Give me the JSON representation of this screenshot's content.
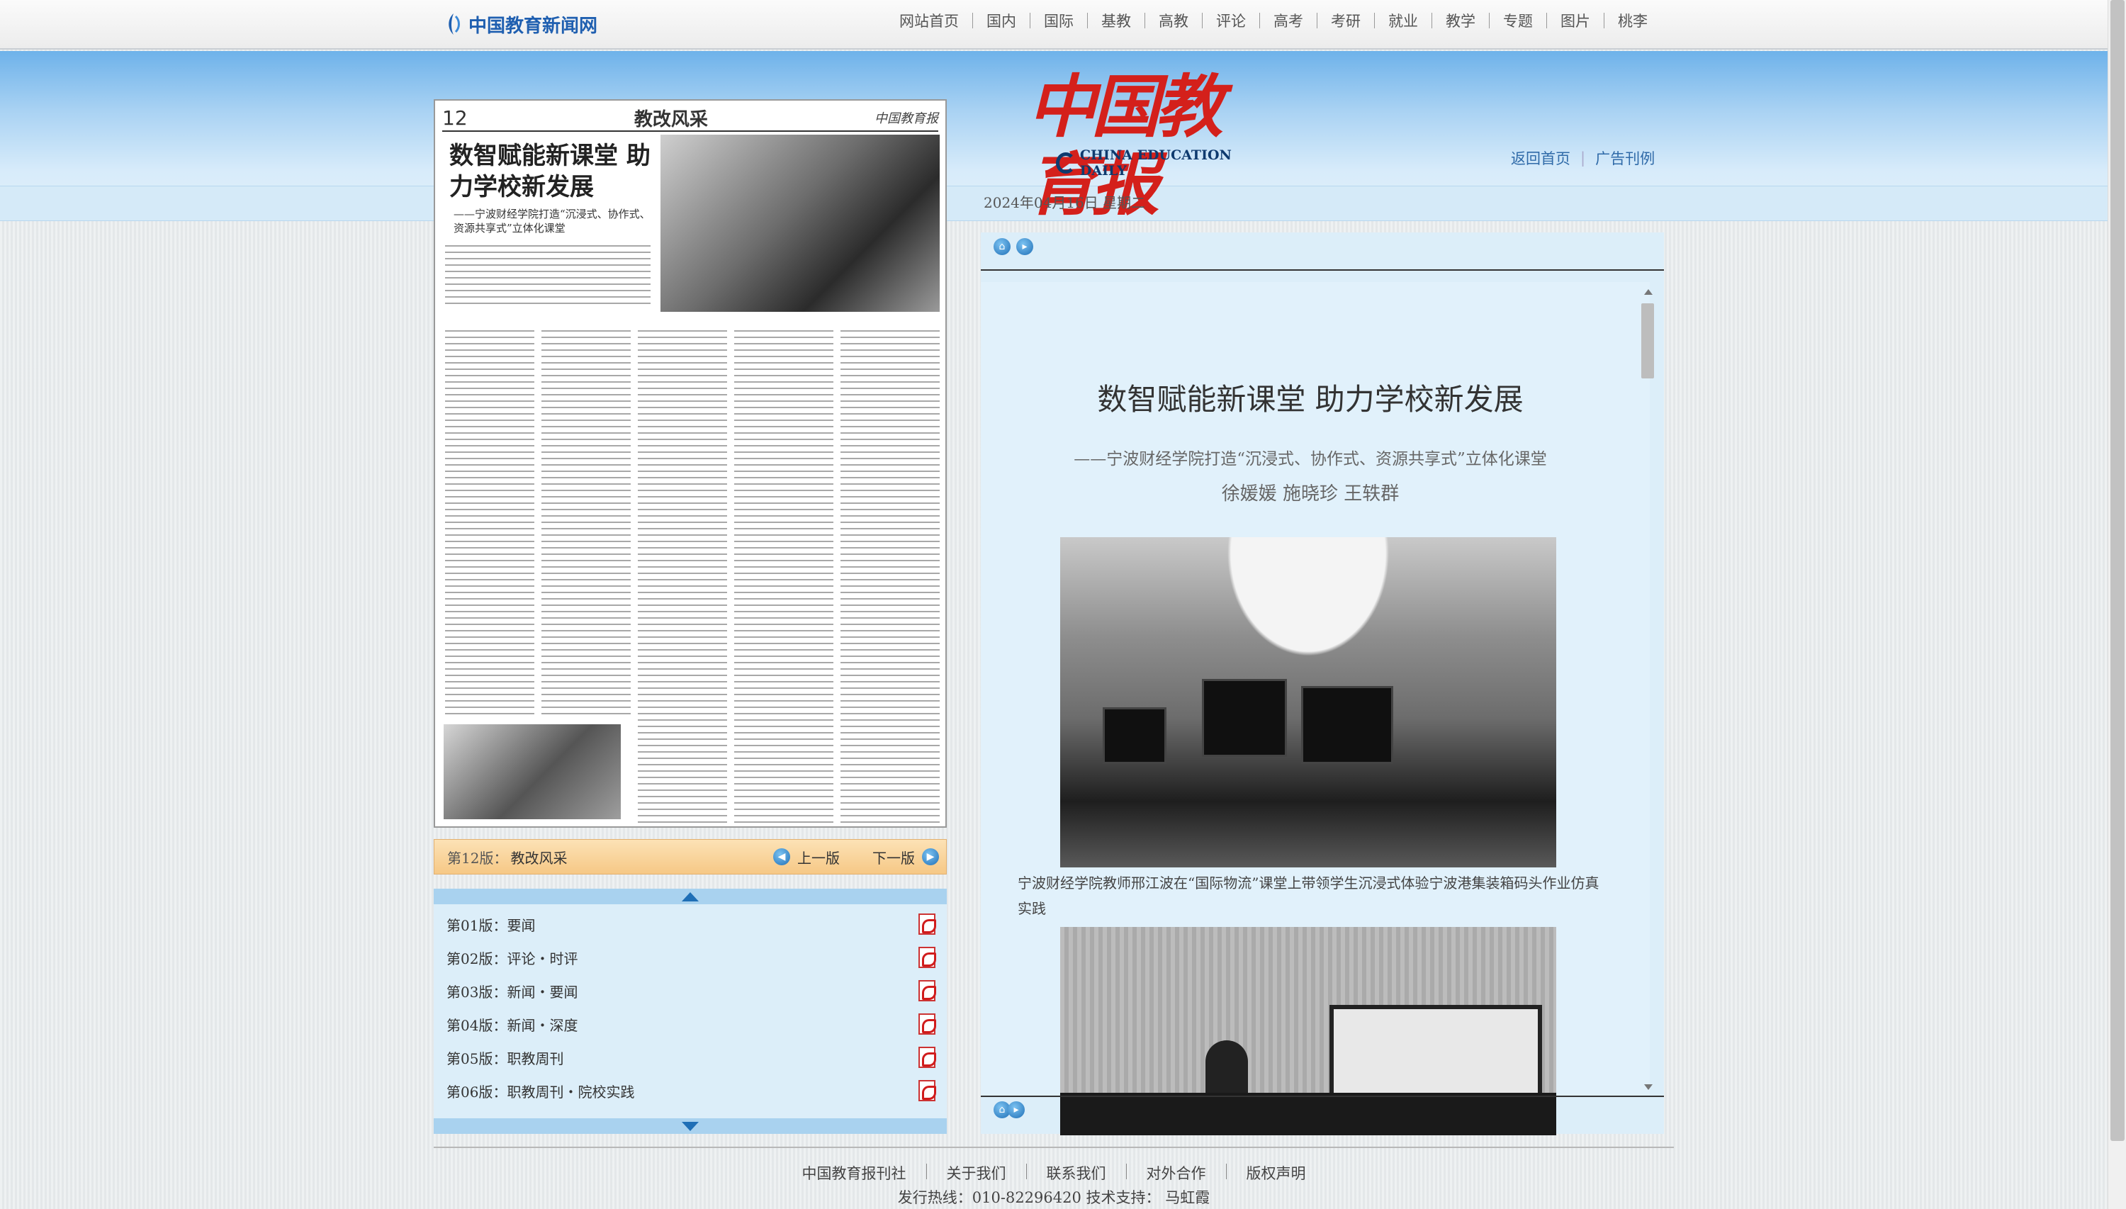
{
  "site": {
    "logo_text": "中国教育新闻网"
  },
  "nav": [
    "网站首页",
    "国内",
    "国际",
    "基教",
    "高教",
    "评论",
    "高考",
    "考研",
    "就业",
    "教学",
    "专题",
    "图片",
    "桃李"
  ],
  "masthead": {
    "cn": "中国教育报",
    "en": "CHINA EDUCATION DAILY"
  },
  "header_links": {
    "home": "返回首页",
    "ads": "广告刊例"
  },
  "date": "2024年04月16日  星期二",
  "paper": {
    "page_no": "12",
    "section": "教改风采",
    "name": "中国教育报",
    "headline": "数智赋能新课堂 助力学校新发展",
    "subhead": "——宁波财经学院打造“沉浸式、协作式、资源共享式”立体化课堂"
  },
  "version_bar": {
    "current_label": "第12版：",
    "current_name": "教改风采",
    "prev": "上一版",
    "next": "下一版"
  },
  "versions": [
    {
      "label": "第01版：",
      "name": "要闻"
    },
    {
      "label": "第02版：",
      "name": "评论・时评"
    },
    {
      "label": "第03版：",
      "name": "新闻・要闻"
    },
    {
      "label": "第04版：",
      "name": "新闻・深度"
    },
    {
      "label": "第05版：",
      "name": "职教周刊"
    },
    {
      "label": "第06版：",
      "name": "职教周刊・院校实践"
    }
  ],
  "article": {
    "title": "数智赋能新课堂  助力学校新发展",
    "subtitle": "——宁波财经学院打造“沉浸式、协作式、资源共享式”立体化课堂",
    "authors": "徐媛媛  施晓珍  王轶群",
    "caption": "宁波财经学院教师邢江波在“国际物流”课堂上带领学生沉浸式体验宁波港集装箱码头作业仿真实践"
  },
  "footer": {
    "links": [
      "中国教育报刊社",
      "关于我们",
      "联系我们",
      "对外合作",
      "版权声明"
    ],
    "info": "发行热线：010-82296420  技术支持：  马虹霞"
  },
  "colors": {
    "accent_blue": "#1f6fb6",
    "masthead_red": "#d4201b",
    "version_bar": "#f6c886"
  }
}
